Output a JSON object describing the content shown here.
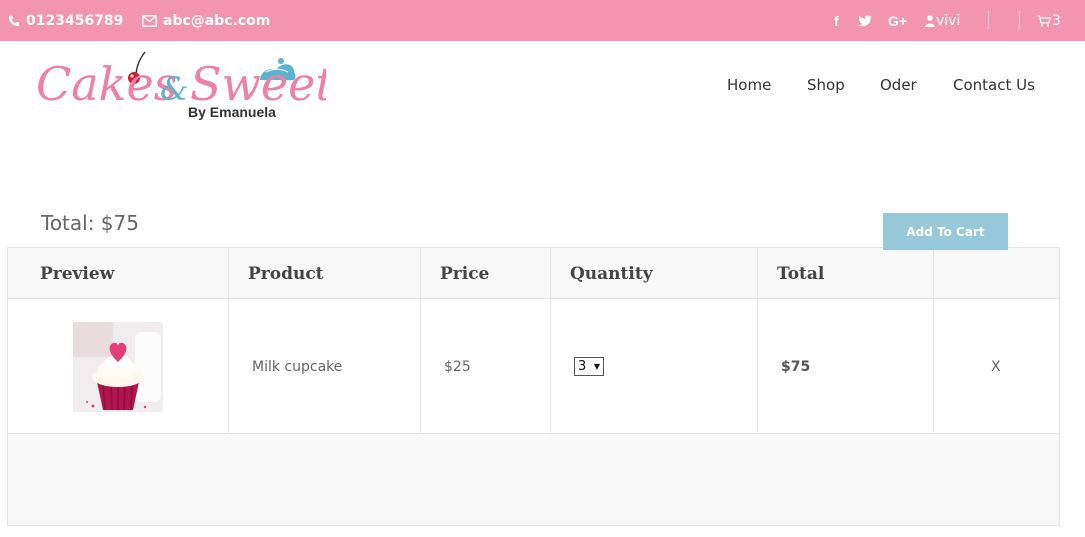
{
  "topbar": {
    "phone": "0123456789",
    "email": "abc@abc.com",
    "social": [
      "f",
      "t",
      "G+"
    ],
    "user": "vivi",
    "cart_count": "3",
    "background": "#f394b1"
  },
  "logo": {
    "title_part1": "Cakes",
    "amp": "&",
    "title_part2": "Sweets",
    "byline": "By Emanuela"
  },
  "nav": {
    "items": [
      "Home",
      "Shop",
      "Oder",
      "Contact Us"
    ]
  },
  "cart": {
    "headers": [
      "Preview",
      "Product",
      "Price",
      "Quantity",
      "Total"
    ],
    "rows": [
      {
        "product": "Milk cupcake",
        "price": "$25",
        "quantity": "3",
        "total": "$75",
        "remove": "X"
      }
    ],
    "grand_total": "Total: $75",
    "add_button": "Add To Cart",
    "accent": "#97c9da"
  }
}
